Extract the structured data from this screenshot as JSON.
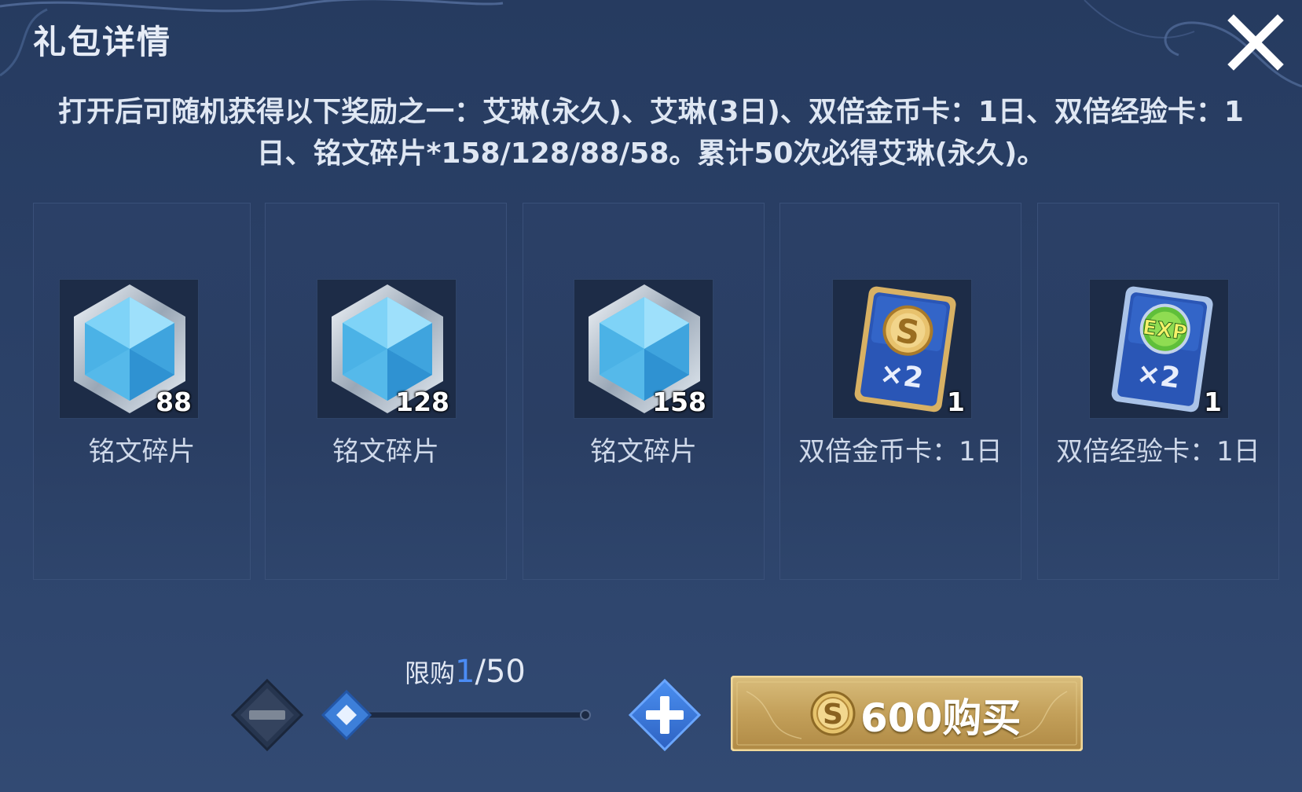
{
  "dialog": {
    "title": "礼包详情",
    "description": "打开后可随机获得以下奖励之一：艾琳(永久)、艾琳(3日)、双倍金币卡：1日、双倍经验卡：1日、铭文碎片*158/128/88/58。累计50次必得艾琳(永久)。",
    "close_icon": "close-icon"
  },
  "rewards": [
    {
      "name": "铭文碎片",
      "count": "88",
      "icon": "crystal-icon"
    },
    {
      "name": "铭文碎片",
      "count": "128",
      "icon": "crystal-icon"
    },
    {
      "name": "铭文碎片",
      "count": "158",
      "icon": "crystal-icon"
    },
    {
      "name": "双倍金币卡：1日",
      "count": "1",
      "icon": "double-gold-card-icon"
    },
    {
      "name": "双倍经验卡：1日",
      "count": "1",
      "icon": "double-exp-card-icon"
    }
  ],
  "purchase": {
    "limit_label": "限购",
    "limit_current": "1",
    "limit_max": "/50",
    "quantity_fraction": 0,
    "buy_price": "600购买",
    "currency_icon": "gold-coin-icon"
  },
  "colors": {
    "background": "#2a3f66",
    "accent_blue": "#4b8cf5",
    "gold": "#c9a55a"
  }
}
